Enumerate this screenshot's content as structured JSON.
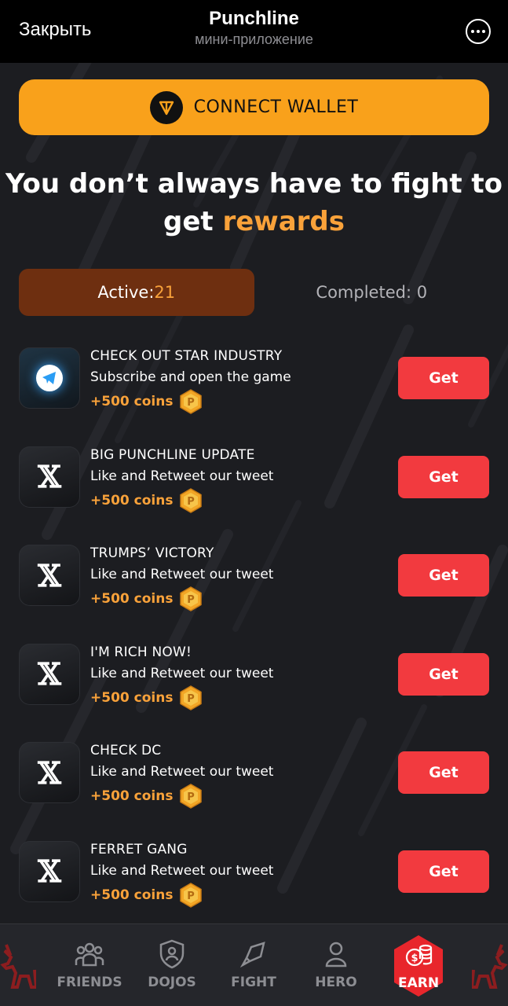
{
  "telegram": {
    "close_label": "Закрыть",
    "title": "Punchline",
    "subtitle": "мини-приложение",
    "more_icon": "more-horizontal-icon"
  },
  "wallet": {
    "label": "CONNECT WALLET",
    "icon": "ton-icon"
  },
  "headline": {
    "part1": "You don’t always have to fight to get ",
    "accent": "rewards"
  },
  "tabs": {
    "active_label": "Active: ",
    "active_count": "21",
    "completed_label": "Completed: 0"
  },
  "tasks": [
    {
      "icon": "telegram-icon",
      "title": "CHECK OUT STAR INDUSTRY",
      "description": "Subscribe and open the game",
      "reward": "+500 coins",
      "button": "Get"
    },
    {
      "icon": "x-icon",
      "title": "BIG PUNCHLINE UPDATE",
      "description": "Like and Retweet our tweet",
      "reward": "+500 coins",
      "button": "Get"
    },
    {
      "icon": "x-icon",
      "title": "TRUMPS’ VICTORY",
      "description": "Like and Retweet our tweet",
      "reward": "+500 coins",
      "button": "Get"
    },
    {
      "icon": "x-icon",
      "title": "I'M RICH NOW!",
      "description": "Like and Retweet our tweet",
      "reward": "+500 coins",
      "button": "Get"
    },
    {
      "icon": "x-icon",
      "title": "CHECK DC",
      "description": "Like and Retweet our tweet",
      "reward": "+500 coins",
      "button": "Get"
    },
    {
      "icon": "x-icon",
      "title": "FERRET GANG",
      "description": "Like and Retweet our tweet",
      "reward": "+500 coins",
      "button": "Get"
    }
  ],
  "coin_glyph": "P",
  "x_glyph": "𝕏",
  "nav": {
    "friends": "FRIENDS",
    "dojos": "DOJOS",
    "fight": "FIGHT",
    "hero": "HERO",
    "earn": "EARN"
  },
  "colors": {
    "accent_orange": "#f9a11b",
    "get_button": "#f23a3f",
    "active_tab": "#6e2f10",
    "earn_badge": "#e8262c"
  }
}
